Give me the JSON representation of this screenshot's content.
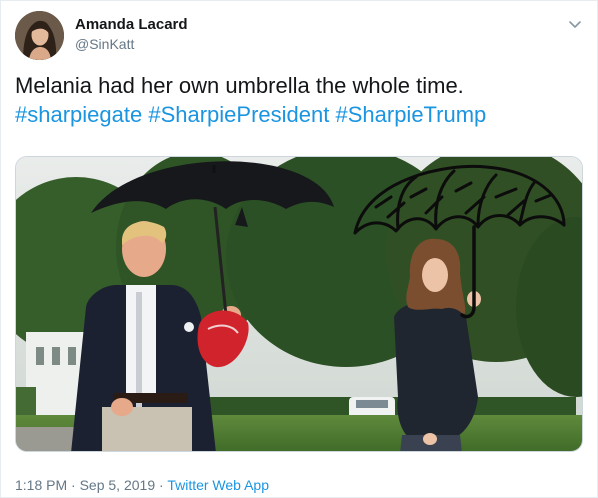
{
  "user": {
    "display_name": "Amanda Lacard",
    "handle": "@SinKatt",
    "avatar_icon": "profile-photo"
  },
  "tweet": {
    "text": "Melania had her own umbrella the whole time.",
    "hashtags": [
      "#sharpiegate",
      "#SharpiePresident",
      "#SharpieTrump"
    ]
  },
  "meta": {
    "time": "1:18 PM",
    "separator": "·",
    "date": "Sep 5, 2019",
    "source": "Twitter Web App"
  },
  "colors": {
    "link": "#1b95e0",
    "secondary_text": "#657786"
  },
  "icons": {
    "menu": "chevron-down-icon"
  }
}
